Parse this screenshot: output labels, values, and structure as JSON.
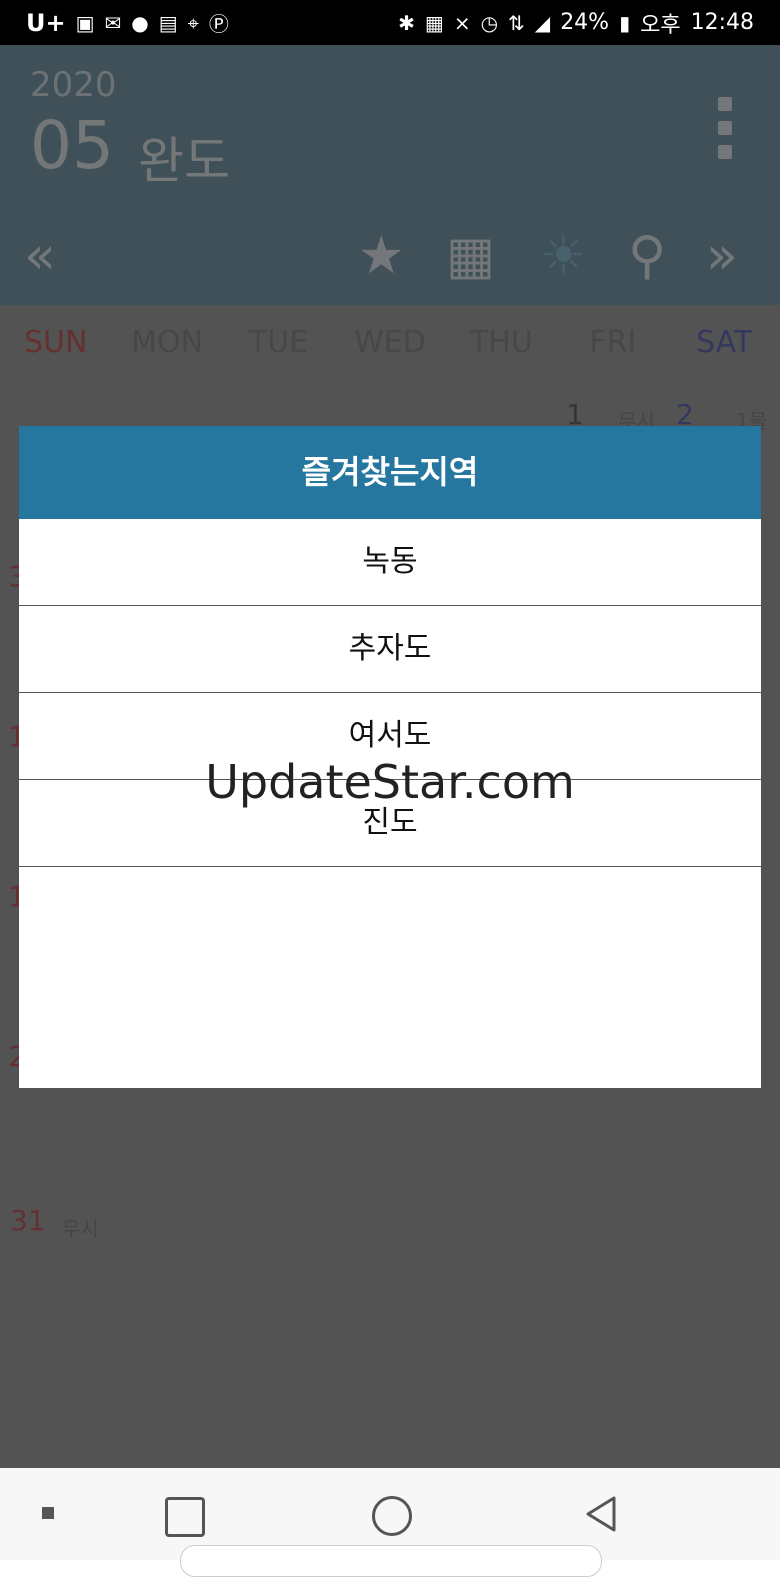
{
  "status_bar": {
    "carrier": "U+",
    "battery": "24%",
    "ampm": "오후",
    "time": "12:48",
    "icons": [
      "image-icon",
      "message-icon",
      "kakaotalk-icon",
      "wallet-icon",
      "usb-icon",
      "p-icon",
      "bluetooth-icon",
      "nfc-icon",
      "mute-icon",
      "alarm-icon",
      "lte-icon",
      "signal-icon",
      "battery-icon"
    ]
  },
  "header": {
    "year": "2020",
    "month": "05",
    "region": "완도"
  },
  "toolbar": {
    "prev_icon": "double-chevron-left-icon",
    "favorite_icon": "star-icon",
    "calendar_icon": "calendar-icon",
    "weather_icon": "sun-icon",
    "location_icon": "location-pin-icon",
    "next_icon": "double-chevron-right-icon"
  },
  "weekdays": [
    "SUN",
    "MON",
    "TUE",
    "WED",
    "THU",
    "FRI",
    "SAT"
  ],
  "calendar": {
    "cells": [
      {
        "num": "1",
        "sub": "무시",
        "color": "default"
      },
      {
        "num": "2",
        "sub": "1물",
        "color": "blue"
      },
      {
        "num": "3",
        "sub": "",
        "color": "red"
      },
      {
        "num": "1",
        "sub": "",
        "color": "red"
      },
      {
        "num": "1",
        "sub": "",
        "color": "red"
      },
      {
        "num": "2",
        "sub": "",
        "color": "red"
      },
      {
        "num": "31",
        "sub": "무시",
        "color": "red"
      }
    ]
  },
  "dialog": {
    "title": "즐겨찾는지역",
    "items": [
      "녹동",
      "추자도",
      "여서도",
      "진도"
    ]
  },
  "watermark": "UpdateStar.com",
  "colors": {
    "header_bg": "#7fa0b0",
    "dialog_title_bg": "#2677a0",
    "sunday": "#c86060",
    "saturday": "#6670b8"
  }
}
